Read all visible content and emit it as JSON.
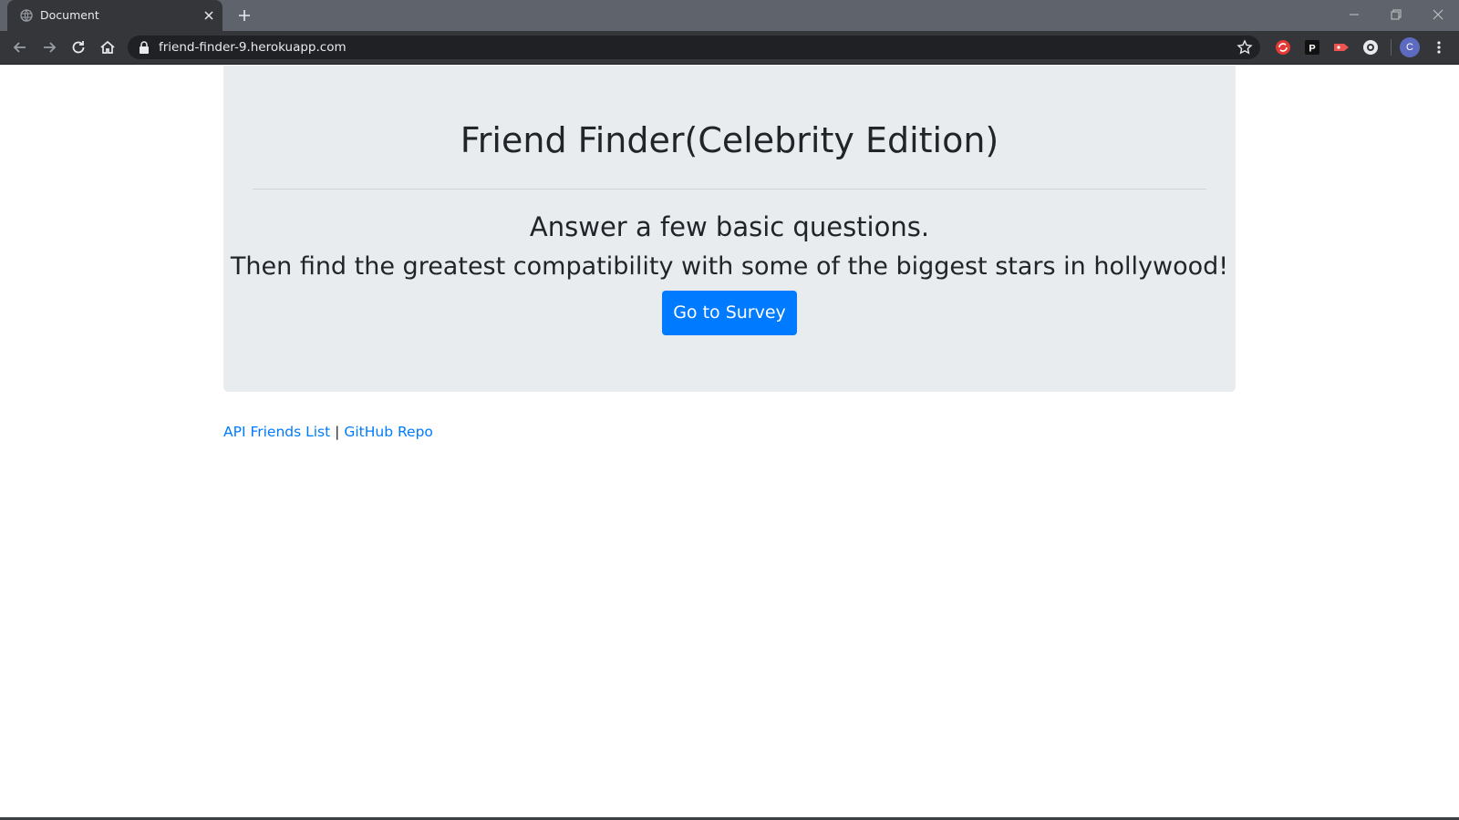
{
  "browser": {
    "tab_title": "Document",
    "url": "friend-finder-9.herokuapp.com",
    "profile_initial": "C"
  },
  "page": {
    "title": "Friend Finder(Celebrity Edition)",
    "lead_line1": "Answer a few basic questions.",
    "lead_line2": "Then find the greatest compatibility with some of the biggest stars in hollywood!",
    "survey_button": "Go to Survey",
    "footer": {
      "link1": "API Friends List",
      "separator": "|",
      "link2": "GitHub Repo"
    }
  },
  "colors": {
    "jumbotron_bg": "#e9ecef",
    "primary": "#007bff",
    "text": "#212529"
  }
}
